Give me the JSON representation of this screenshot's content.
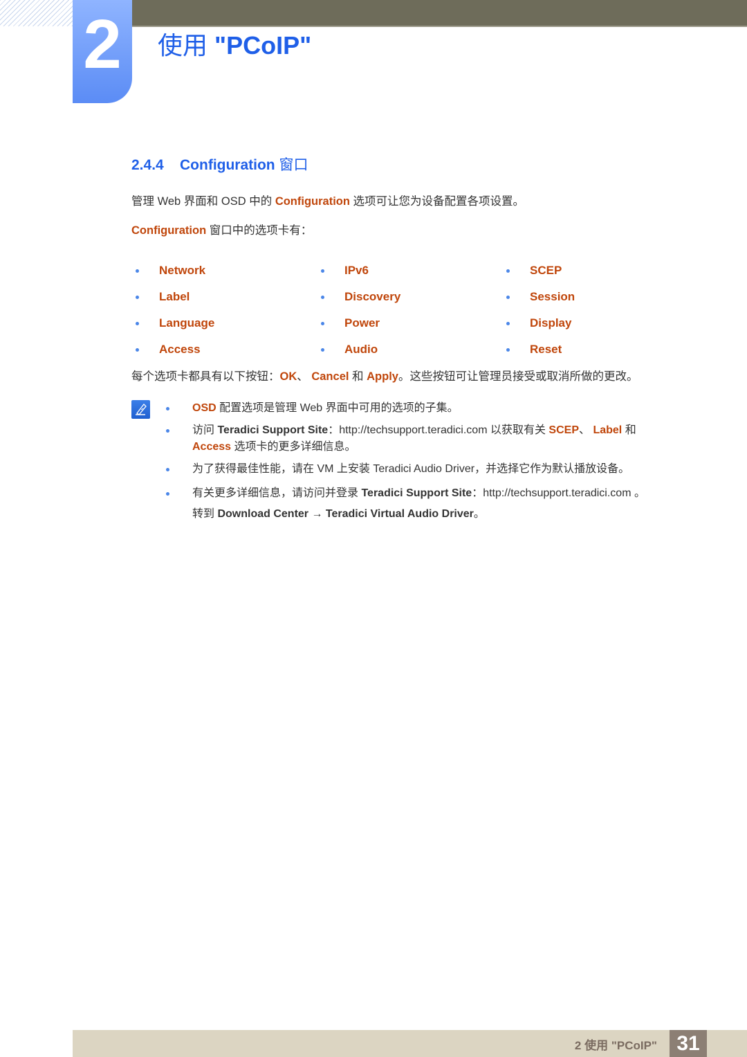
{
  "header": {
    "chapter_number": "2",
    "chapter_title_cjk": "使用 ",
    "chapter_title_bold": "\"PCoIP\""
  },
  "section": {
    "number": "2.4.4",
    "title": "Configuration",
    "title_suffix": "窗口"
  },
  "intro": {
    "p1_a": "管理 Web 界面和 OSD 中的 ",
    "p1_hl": "Configuration",
    "p1_b": " 选项可让您为设备配置各项设置。",
    "p2_hl": "Configuration",
    "p2_b": " 窗口中的选项卡有："
  },
  "tabs": [
    "Network",
    "IPv6",
    "SCEP",
    "Label",
    "Discovery",
    "Session",
    "Language",
    "Power",
    "Display",
    "Access",
    "Audio",
    "Reset"
  ],
  "buttons_para": {
    "a": "每个选项卡都具有以下按钮：",
    "ok": "OK",
    "sep": "、 ",
    "cancel": "Cancel",
    "and": " 和 ",
    "apply": "Apply",
    "b": "。这些按钮可让管理员接受或取消所做的更改。"
  },
  "notes": {
    "n1_hl": "OSD",
    "n1_b": " 配置选项是管理 Web 界面中可用的选项的子集。",
    "n2_a": "访问 ",
    "n2_site": "Teradici Support Site",
    "n2_b": "：http://techsupport.teradici.com 以获取有关 ",
    "n2_scep": "SCEP",
    "n2_sep": "、 ",
    "n2_label": "Label",
    "n2_and": " 和",
    "n2_access": "Access",
    "n2_c": " 选项卡的更多详细信息。",
    "n3": "为了获得最佳性能，请在 VM 上安装 Teradici Audio Driver，并选择它作为默认播放设备。",
    "n4_a": "有关更多详细信息，请访问并登录 ",
    "n4_site": "Teradici Support Site",
    "n4_b": "：http://techsupport.teradici.com 。",
    "n4_c": "转到 ",
    "n4_dl": "Download Center",
    "n4_arrow": " → ",
    "n4_driver": "Teradici Virtual Audio Driver",
    "n4_end": "。"
  },
  "footer": {
    "chapter": "2 使用 ",
    "chapter_bold": "\"PCoIP\"",
    "page_number": "31"
  }
}
